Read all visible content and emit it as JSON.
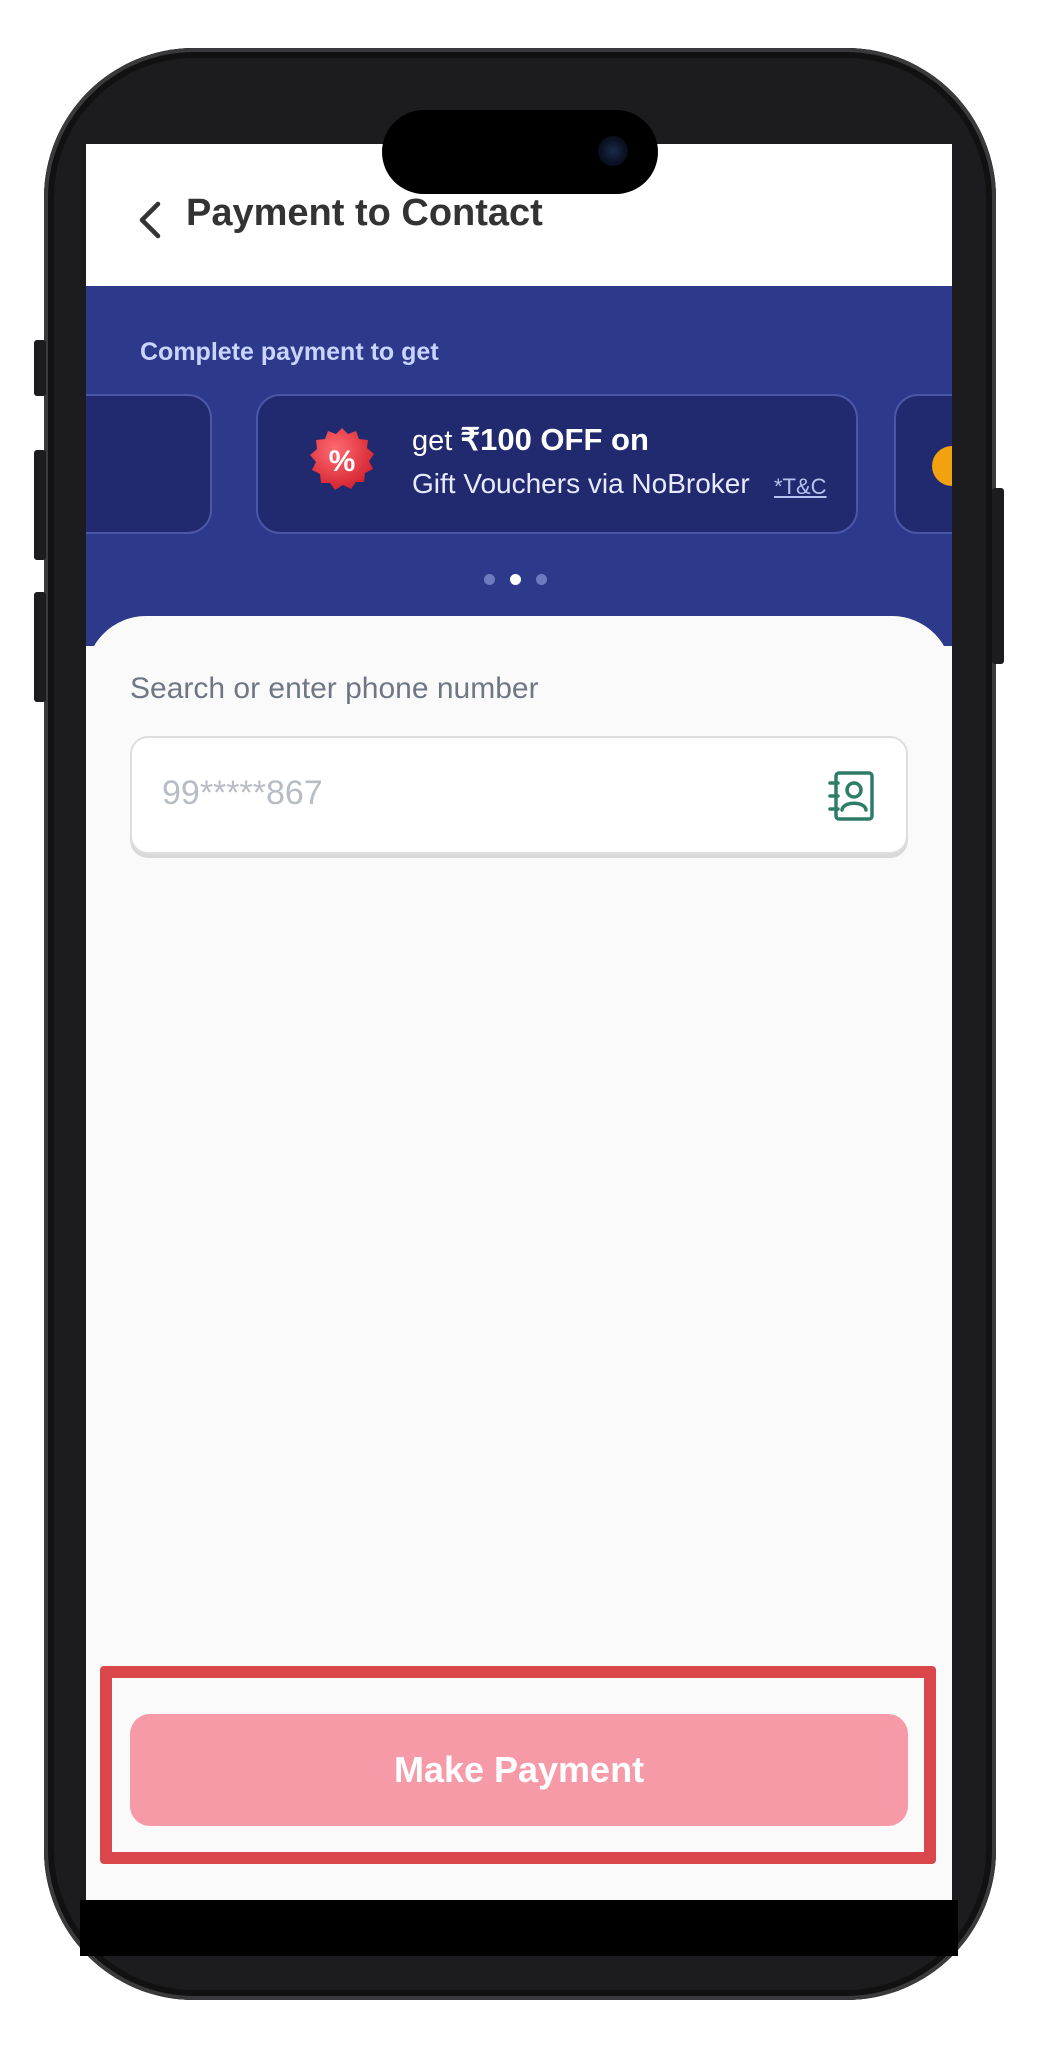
{
  "header": {
    "back_icon": "chevron-left-icon",
    "title": "Payment to Contact"
  },
  "banner": {
    "label": "Complete payment to get",
    "offer": {
      "icon": "percent-badge-icon",
      "prefix": "get ",
      "highlight": "₹100 OFF on",
      "line2": "Gift Vouchers via NoBroker",
      "tnc": "*T&C"
    },
    "pager": {
      "count": 3,
      "active": 2
    },
    "colors": {
      "background": "#2d3a8c",
      "card": "#212a6e"
    }
  },
  "search": {
    "label": "Search or enter phone number",
    "value": "99*****867",
    "contact_icon": "contact-book-icon"
  },
  "footer": {
    "button_label": "Make Payment",
    "button_color": "#f79aa8",
    "highlight_color": "#d9474a"
  }
}
